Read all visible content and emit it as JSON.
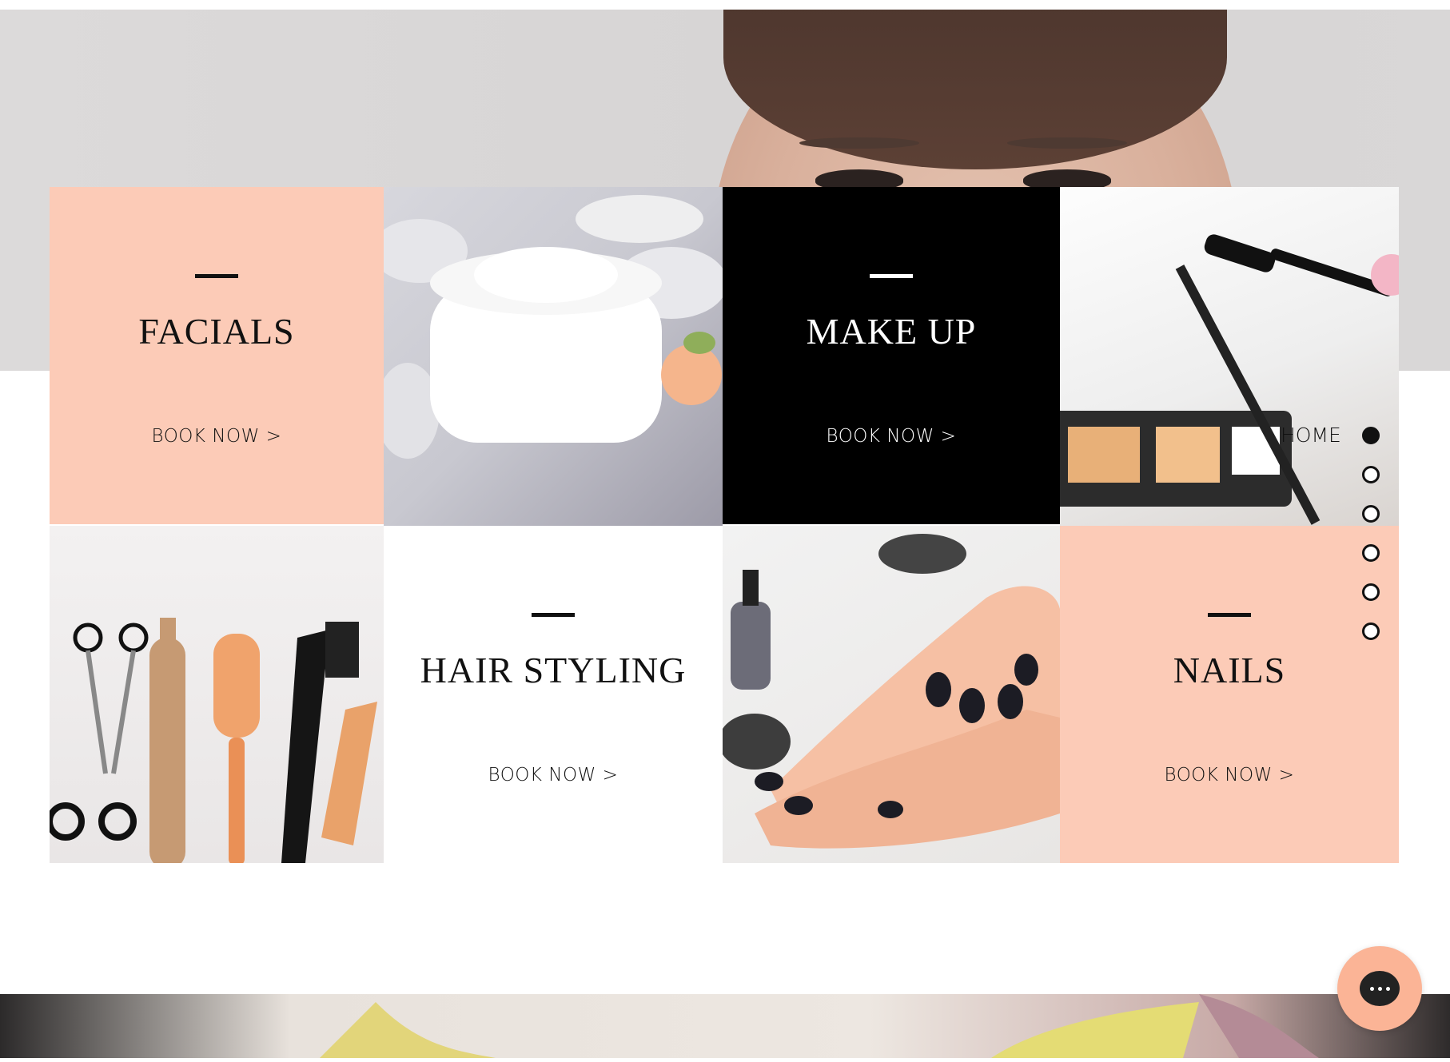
{
  "services": [
    {
      "title": "FACIALS",
      "cta": "BOOK NOW >"
    },
    {
      "title": "MAKE UP",
      "cta": "BOOK NOW >"
    },
    {
      "title": "HAIR STYLING",
      "cta": "BOOK NOW >"
    },
    {
      "title": "NAILS",
      "cta": "BOOK NOW >"
    }
  ],
  "side_nav": {
    "active_label": "HOME",
    "count": 6,
    "active_index": 0
  },
  "colors": {
    "peach": "#fccbb7",
    "black": "#000000",
    "chat": "#fbb496"
  },
  "icons": {
    "chat": "chat-bubble-icon"
  }
}
